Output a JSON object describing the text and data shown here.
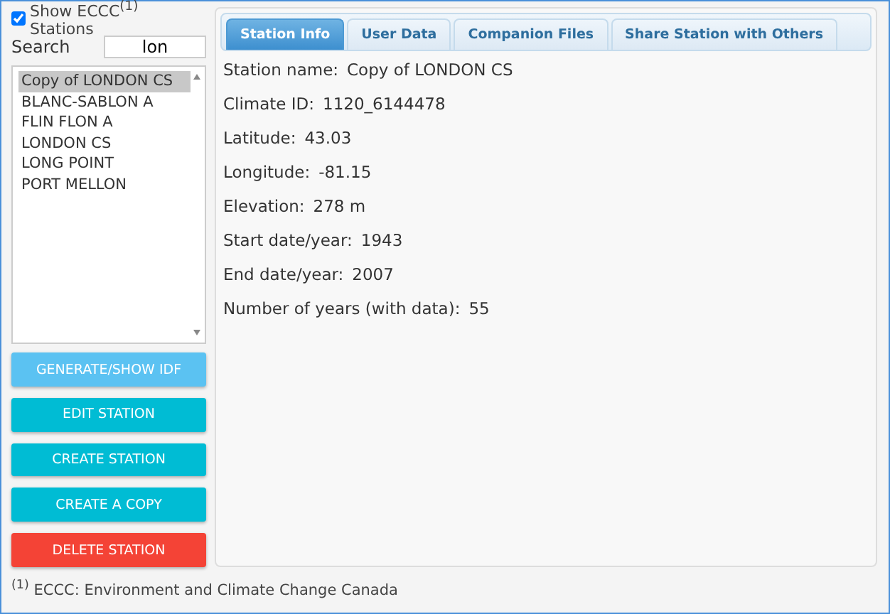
{
  "show_stations": {
    "label": "Show ECCC$^{(1)}$ Stations",
    "checked": true
  },
  "search": {
    "label": "Search",
    "value": "lon"
  },
  "stations": [
    {
      "name": "Copy of LONDON CS",
      "selected": true
    },
    {
      "name": "BLANC-SABLON A",
      "selected": false
    },
    {
      "name": "FLIN FLON A",
      "selected": false
    },
    {
      "name": "LONDON CS",
      "selected": false
    },
    {
      "name": "LONG POINT",
      "selected": false
    },
    {
      "name": "PORT MELLON",
      "selected": false
    }
  ],
  "buttons": [
    {
      "label": "GENERATE/SHOW IDF",
      "kind": "light"
    },
    {
      "label": "EDIT STATION",
      "kind": "teal"
    },
    {
      "label": "CREATE STATION",
      "kind": "teal"
    },
    {
      "label": "CREATE A COPY",
      "kind": "teal"
    },
    {
      "label": "DELETE STATION",
      "kind": "danger"
    }
  ],
  "tabs": [
    {
      "label": "Station Info",
      "selected": true
    },
    {
      "label": "User Data",
      "selected": false
    },
    {
      "label": "Companion Files",
      "selected": false
    },
    {
      "label": "Share Station with Others",
      "selected": false
    }
  ],
  "fields": [
    {
      "label": "Station name:",
      "value": "Copy of LONDON CS"
    },
    {
      "label": "Climate ID:",
      "value": "1120_6144478"
    },
    {
      "label": "Latitude:",
      "value": "43.03"
    },
    {
      "label": "Longitude:",
      "value": "-81.15"
    },
    {
      "label": "Elevation:",
      "value": "278 m"
    },
    {
      "label": "Start date/year:",
      "value": "1943"
    },
    {
      "label": "End date/year:",
      "value": "2007"
    },
    {
      "label": "Number of years (with data):",
      "value": "55"
    }
  ],
  "footnote": "$^{(1)}$ ECCC: Environment and Climate Change Canada"
}
